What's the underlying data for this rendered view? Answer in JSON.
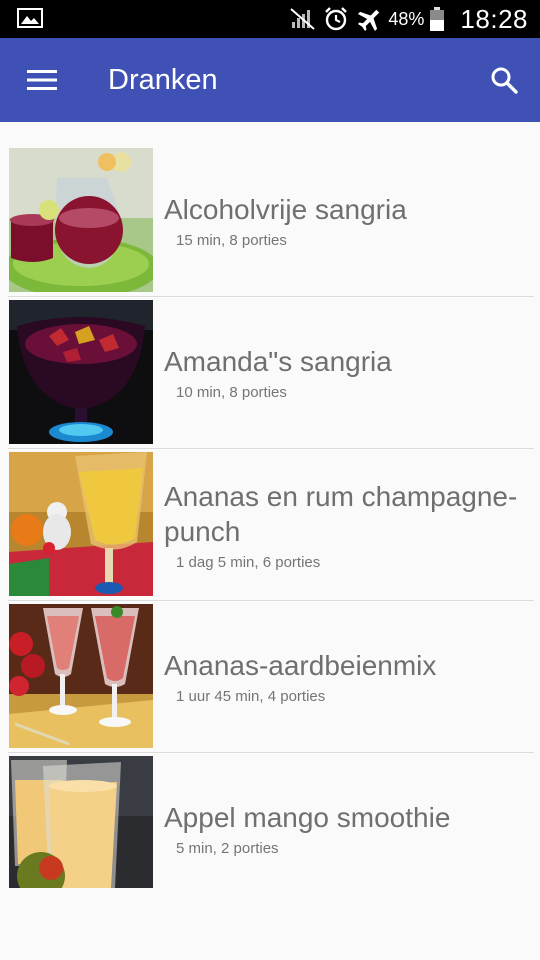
{
  "status_bar": {
    "battery_percent": "48%",
    "time": "18:28",
    "icons": [
      "gallery-icon",
      "no-signal-icon",
      "alarm-icon",
      "airplane-mode-icon",
      "battery-icon"
    ]
  },
  "app_bar": {
    "title": "Dranken",
    "menu_icon": "hamburger-menu-icon",
    "search_icon": "search-icon",
    "background_color": "#3f51b5"
  },
  "recipes": [
    {
      "title": "Alcoholvrije sangria",
      "meta": "15 min, 8 porties"
    },
    {
      "title": "Amanda\"s sangria",
      "meta": "10 min, 8 porties"
    },
    {
      "title": "Ananas en rum champagne-punch",
      "meta": "1 dag 5 min, 6 porties"
    },
    {
      "title": "Ananas-aardbeienmix",
      "meta": "1 uur 45 min, 4 porties"
    },
    {
      "title": "Appel mango smoothie",
      "meta": "5 min, 2 porties"
    }
  ]
}
